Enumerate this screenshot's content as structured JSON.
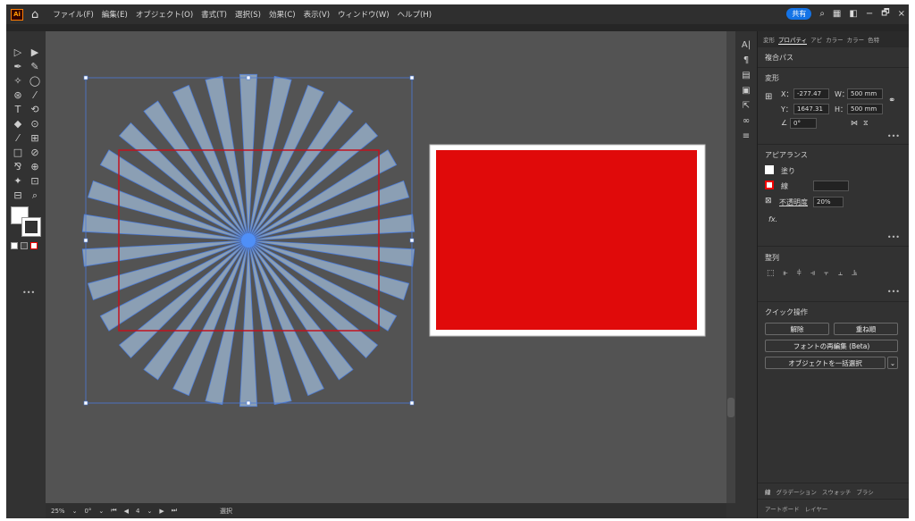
{
  "app": {
    "logo": "Ai",
    "home_icon": "home-icon"
  },
  "menu": [
    "ファイル(F)",
    "編集(E)",
    "オブジェクト(O)",
    "書式(T)",
    "選択(S)",
    "効果(C)",
    "表示(V)",
    "ウィンドウ(W)",
    "ヘルプ(H)"
  ],
  "topright": {
    "share": "共有",
    "search_icon": "search-icon",
    "minimize": "−",
    "restore": "🗗",
    "close": "×"
  },
  "tools": [
    "▷",
    "▶",
    "✒",
    "✎",
    "✧",
    "◯",
    "⊛",
    "⁄",
    "T",
    "⟲",
    "◆",
    "⊙",
    "⁄",
    "⊞",
    "□",
    "⊘",
    "⅋",
    "⊕",
    "✦",
    "⊡",
    "⊟",
    "⌕"
  ],
  "panel": {
    "tabs": [
      "変形",
      "プロパティ",
      "アピ",
      "カラー",
      "カラー",
      "色特"
    ],
    "active_tab": "プロパティ",
    "object_type": "複合パス",
    "transform_title": "変形",
    "x_label": "X：",
    "x_value": "-277.47",
    "y_label": "Y：",
    "y_value": "1647.31",
    "w_label": "W：",
    "w_value": "500 mm",
    "h_label": "H：",
    "h_value": "500 mm",
    "angle_value": "0°",
    "appearance_title": "アピアランス",
    "fill_label": "塗り",
    "stroke_label": "線",
    "opacity_label": "不透明度",
    "opacity_value": "20%",
    "fx_label": "fx.",
    "align_title": "整列",
    "quick_title": "クイック操作",
    "btn_release": "解除",
    "btn_order": "重ね順",
    "btn_font": "フォントの再編集 (Beta)",
    "btn_select_all": "オブジェクトを一括選択",
    "more": "•••",
    "bottom_tabs": [
      "線",
      "グラデーション",
      "スウォッチ",
      "ブラシ"
    ],
    "bottom_tabs2": [
      "アートボード",
      "レイヤー"
    ]
  },
  "status": {
    "zoom": "25%",
    "rotation": "0°",
    "page": "4",
    "mode": "選択"
  },
  "colors": {
    "accent": "#1473e6",
    "ray_fill": "#8b9fb4",
    "ray_stroke": "#4b7bd7",
    "red": "#e00a0a",
    "canvas": "#535353"
  }
}
